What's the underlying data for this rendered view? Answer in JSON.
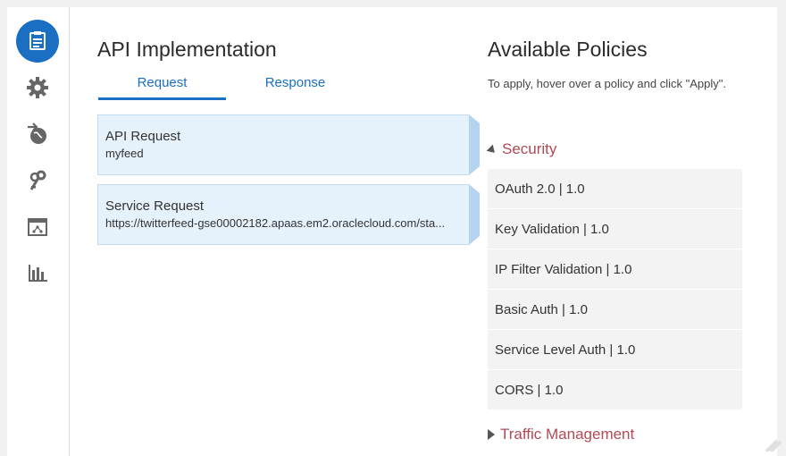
{
  "left": {
    "title": "API Implementation",
    "tabs": [
      {
        "label": "Request",
        "active": true
      },
      {
        "label": "Response",
        "active": false
      }
    ],
    "cards": [
      {
        "title": "API Request",
        "subtitle": "myfeed"
      },
      {
        "title": "Service Request",
        "subtitle": "https://twitterfeed-gse00002182.apaas.em2.oraclecloud.com/sta..."
      }
    ]
  },
  "right": {
    "title": "Available Policies",
    "hint": "To apply, hover over a policy and click \"Apply\".",
    "sections": [
      {
        "label": "Security",
        "expanded": true,
        "policies": [
          "OAuth 2.0 | 1.0",
          "Key Validation | 1.0",
          "IP Filter Validation | 1.0",
          "Basic Auth | 1.0",
          "Service Level Auth | 1.0",
          "CORS | 1.0"
        ]
      },
      {
        "label": "Traffic Management",
        "expanded": false
      }
    ]
  },
  "sidebar": {
    "icons": [
      "api-implementation-icon",
      "settings-icon",
      "deployment-icon",
      "grants-icon",
      "api-portal-icon",
      "analytics-icon"
    ]
  },
  "colors": {
    "accent": "#1a6fc2",
    "section": "#b04a55",
    "card_bg": "#e5f1fb",
    "policy_bg": "#f3f3f3"
  }
}
